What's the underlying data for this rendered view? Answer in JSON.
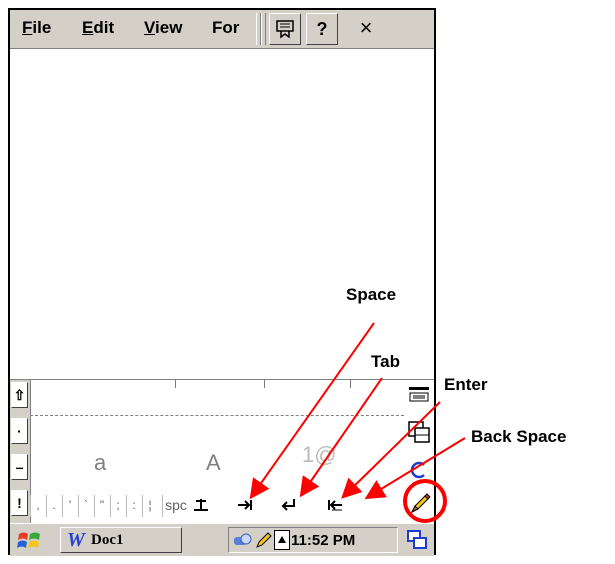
{
  "menubar": {
    "items": [
      {
        "label": "File",
        "accel": "F",
        "rest": "ile"
      },
      {
        "label": "Edit",
        "accel": "E",
        "rest": "dit"
      },
      {
        "label": "View",
        "accel": "V",
        "rest": "iew"
      },
      {
        "label": "For",
        "accel": "",
        "rest": "For"
      }
    ],
    "help_label": "?",
    "close_label": "×"
  },
  "sip": {
    "left_buttons": [
      "⇧",
      "·",
      "–",
      "!"
    ],
    "zones": [
      "a",
      "A",
      "1@"
    ],
    "punctuation": [
      ",",
      ".",
      "'",
      "`",
      "\"",
      ";",
      ":",
      "¦"
    ],
    "spc_label": "spc"
  },
  "taskbar": {
    "doc_label": "Doc1",
    "clock": "11:52 PM"
  },
  "callouts": {
    "space": "Space",
    "tab": "Tab",
    "enter": "Enter",
    "backspace": "Back Space"
  },
  "colors": {
    "arrow": "#ff0000",
    "chrome": "#d4d0c8"
  }
}
